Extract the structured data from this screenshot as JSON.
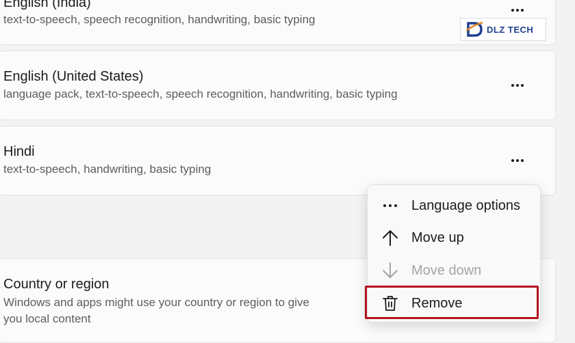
{
  "languages": [
    {
      "name": "English (India)",
      "features": "text-to-speech, speech recognition, handwriting, basic typing"
    },
    {
      "name": "English (United States)",
      "features": "language pack, text-to-speech, speech recognition, handwriting, basic typing"
    },
    {
      "name": "Hindi",
      "features": "text-to-speech, handwriting, basic typing"
    }
  ],
  "region": {
    "title": "Country or region",
    "description_line1": "Windows and apps might use your country or region to give",
    "description_line2": "you local content"
  },
  "menu": {
    "language_options": "Language options",
    "move_up": "Move up",
    "move_down": "Move down",
    "remove": "Remove"
  },
  "watermark": {
    "text": "DLZ TECH",
    "brand_color": "#1f3f8f",
    "accent_color": "#e08a2a"
  },
  "colors": {
    "highlight": "#b3121e"
  },
  "icons": [
    "more-icon",
    "ellipsis-icon",
    "arrow-up-icon",
    "arrow-down-icon",
    "trash-icon"
  ]
}
